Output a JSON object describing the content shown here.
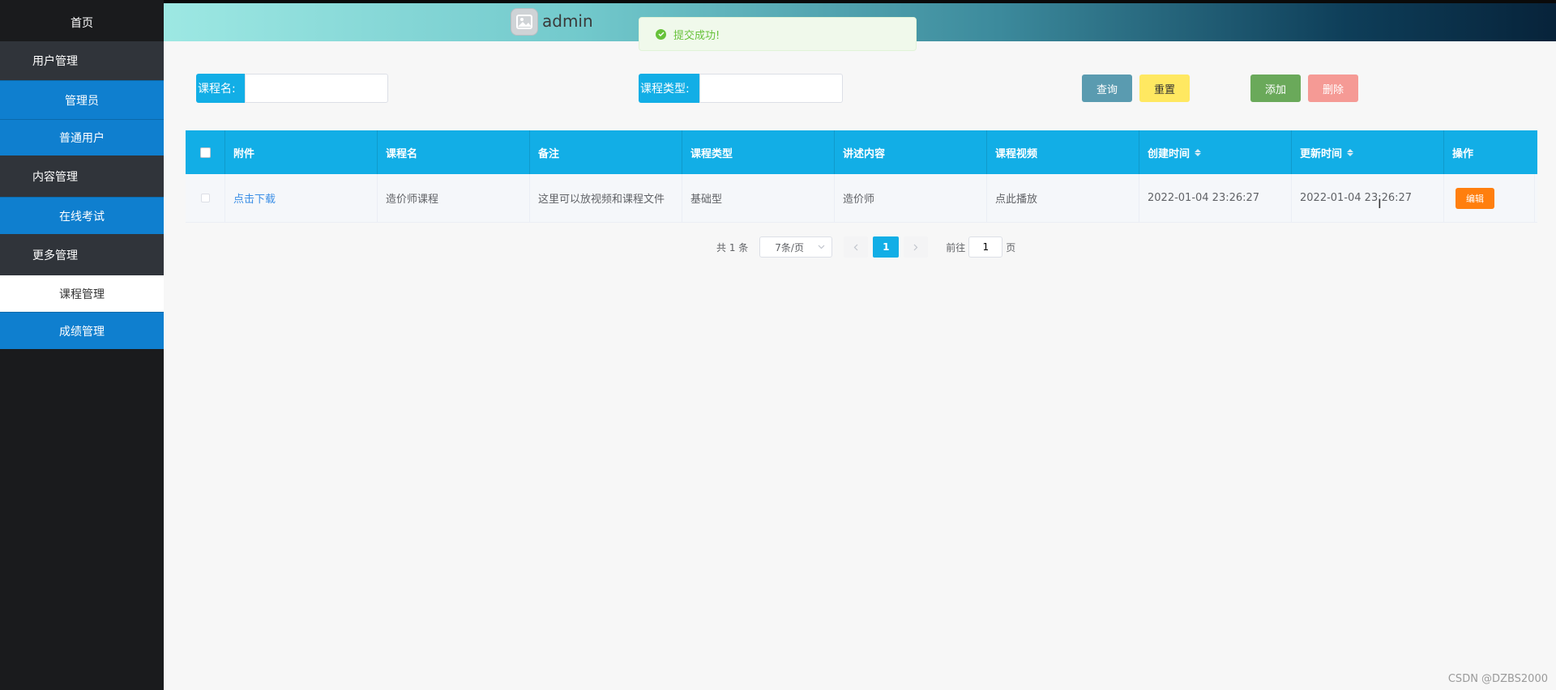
{
  "sidebar": {
    "home": "首页",
    "items": [
      {
        "label": "用户管理",
        "type": "group"
      },
      {
        "label": "管理员",
        "type": "sub"
      },
      {
        "label": "普通用户",
        "type": "sub"
      },
      {
        "label": "内容管理",
        "type": "group"
      },
      {
        "label": "在线考试",
        "type": "sub"
      },
      {
        "label": "更多管理",
        "type": "group"
      },
      {
        "label": "课程管理",
        "type": "active"
      },
      {
        "label": "成绩管理",
        "type": "sub"
      }
    ]
  },
  "header": {
    "username": "admin",
    "avatar_icon": "image-icon"
  },
  "toast": {
    "message": "提交成功!",
    "icon": "check-circle-icon",
    "color": "#67c23a"
  },
  "search": {
    "course_name_label": "课程名:",
    "course_name_value": "",
    "course_type_label": "课程类型:",
    "course_type_value": ""
  },
  "actions": {
    "query": "查询",
    "reset": "重置",
    "add": "添加",
    "delete": "删除",
    "colors": {
      "query": "#5a9bb0",
      "reset": "#ffe861",
      "add": "#6aa95a",
      "delete": "#f59a95"
    }
  },
  "table": {
    "columns": [
      "附件",
      "课程名",
      "备注",
      "课程类型",
      "讲述内容",
      "课程视频",
      "创建时间",
      "更新时间",
      "操作"
    ],
    "rows": [
      {
        "attachment": "点击下载",
        "course_name": "造价师课程",
        "remark": "这里可以放视频和课程文件",
        "course_type": "基础型",
        "content": "造价师",
        "video": "点此播放",
        "created": "2022-01-04 23:26:27",
        "updated": "2022-01-04 23:26:27",
        "edit": "编辑"
      }
    ]
  },
  "pagination": {
    "total": "共 1 条",
    "page_size": "7条/页",
    "current_page": "1",
    "goto_prefix": "前往",
    "goto_value": "1",
    "goto_suffix": "页"
  },
  "watermark": "CSDN @DZBS2000",
  "theme": {
    "accent": "#12aee6",
    "sidebar_bg": "#1a1b1d",
    "sidebar_sub": "#0f7fcf"
  }
}
